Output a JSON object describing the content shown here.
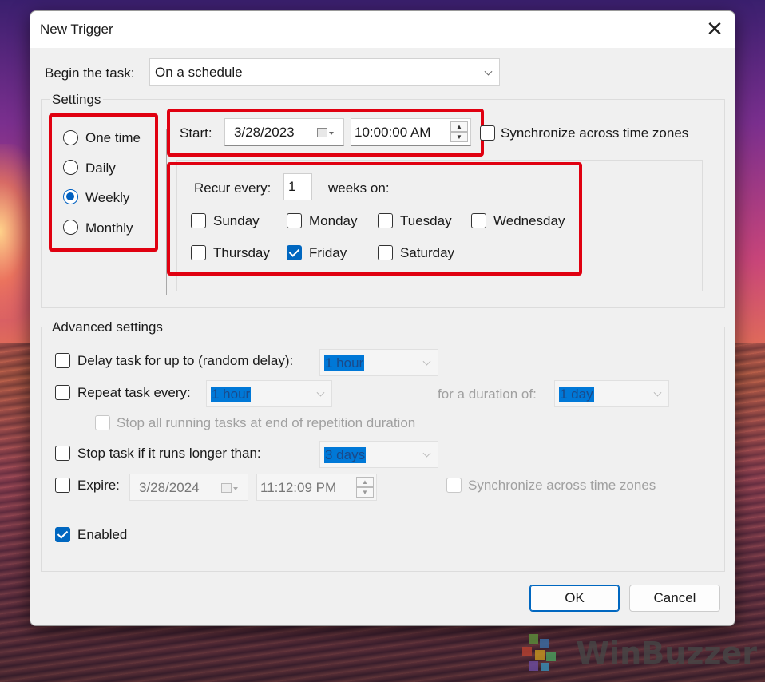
{
  "dialog": {
    "title": "New Trigger",
    "close_glyph": "✕"
  },
  "begin": {
    "label": "Begin the task:",
    "value": "On a schedule"
  },
  "settings": {
    "group_label": "Settings",
    "radios": [
      {
        "label": "One time",
        "checked": false
      },
      {
        "label": "Daily",
        "checked": false
      },
      {
        "label": "Weekly",
        "checked": true
      },
      {
        "label": "Monthly",
        "checked": false
      }
    ],
    "start_label": "Start:",
    "start_date": "3/28/2023",
    "start_time": "10:00:00 AM",
    "sync_label": "Synchronize across time zones",
    "recur_label": "Recur every:",
    "recur_value": "1",
    "recur_suffix": "weeks on:",
    "days": [
      {
        "label": "Sunday",
        "checked": false
      },
      {
        "label": "Monday",
        "checked": false
      },
      {
        "label": "Tuesday",
        "checked": false
      },
      {
        "label": "Wednesday",
        "checked": false
      },
      {
        "label": "Thursday",
        "checked": false
      },
      {
        "label": "Friday",
        "checked": true
      },
      {
        "label": "Saturday",
        "checked": false
      }
    ]
  },
  "advanced": {
    "group_label": "Advanced settings",
    "delay_label": "Delay task for up to (random delay):",
    "delay_value": "1 hour",
    "repeat_label": "Repeat task every:",
    "repeat_value": "1 hour",
    "duration_label": "for a duration of:",
    "duration_value": "1 day",
    "stop_running_label": "Stop all running tasks at end of repetition duration",
    "stop_longer_label": "Stop task if it runs longer than:",
    "stop_longer_value": "3 days",
    "expire_label": "Expire:",
    "expire_date": "3/28/2024",
    "expire_time": "11:12:09 PM",
    "expire_sync_label": "Synchronize across time zones",
    "enabled_label": "Enabled"
  },
  "buttons": {
    "ok": "OK",
    "cancel": "Cancel"
  },
  "watermark": "WinBuzzer",
  "colors": {
    "highlight_box": "#e00010",
    "accent": "#0067c0"
  }
}
